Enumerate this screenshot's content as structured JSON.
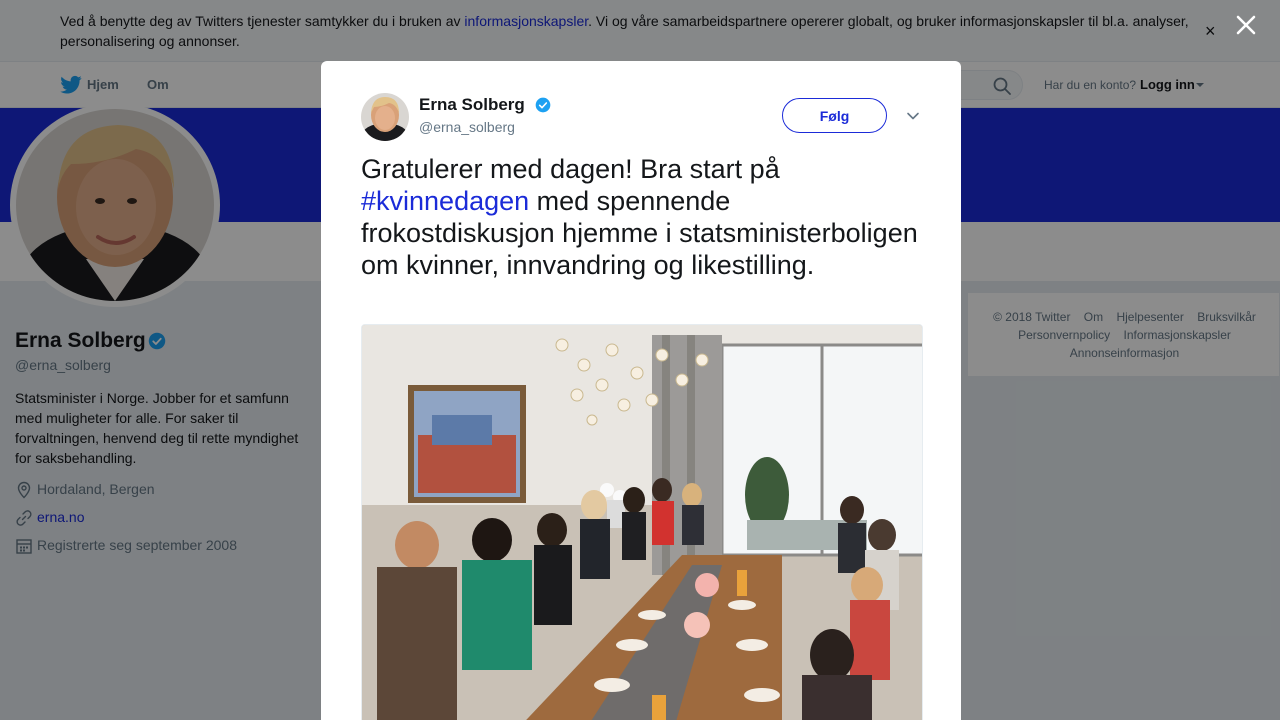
{
  "cookie_bar": {
    "text_before": "Ved å benytte deg av Twitters tjenester samtykker du i bruken av ",
    "link": "informasjonskapsler",
    "text_after": ". Vi og våre samarbeidspartnere opererer globalt, og bruker informasjonskapsler til bl.a. analyser, personalisering og annonser.",
    "close": "×"
  },
  "nav": {
    "home": "Hjem",
    "about": "Om",
    "account_prompt": "Har du en konto?",
    "login": "Logg inn"
  },
  "profile": {
    "name": "Erna Solberg",
    "handle": "@erna_solberg",
    "bio": "Statsminister i Norge. Jobber for et samfunn med muligheter for alle. For saker til forvaltningen, henvend deg til rette myndighet for saksbehandling.",
    "location": "Hordaland, Bergen",
    "website": "erna.no",
    "joined": "Registrerte seg september 2008"
  },
  "footer": {
    "line1": [
      "© 2018 Twitter",
      "Om",
      "Hjelpesenter",
      "Bruksvilkår"
    ],
    "line2": [
      "Personvernpolicy",
      "Informasjonskapsler"
    ],
    "line3": [
      "Annonseinformasjon"
    ]
  },
  "tweet": {
    "name": "Erna Solberg",
    "handle": "@erna_solberg",
    "follow_label": "Følg",
    "text_before": "Gratulerer med dagen! Bra start på ",
    "hashtag": "#kvinnedagen",
    "text_after": " med spennende frokostdiskusjon hjemme i statsministerboligen om kvinner, innvandring og likestilling."
  },
  "icons": {
    "bird": "twitter-bird-icon",
    "search": "search-icon",
    "location": "location-pin-icon",
    "link": "link-icon",
    "calendar": "calendar-icon",
    "verified": "verified-badge-icon",
    "close": "close-icon",
    "caret": "chevron-down-icon"
  },
  "colors": {
    "accent": "#1b2bd8",
    "verified": "#1da1f2",
    "bird": "#1da1f2"
  }
}
